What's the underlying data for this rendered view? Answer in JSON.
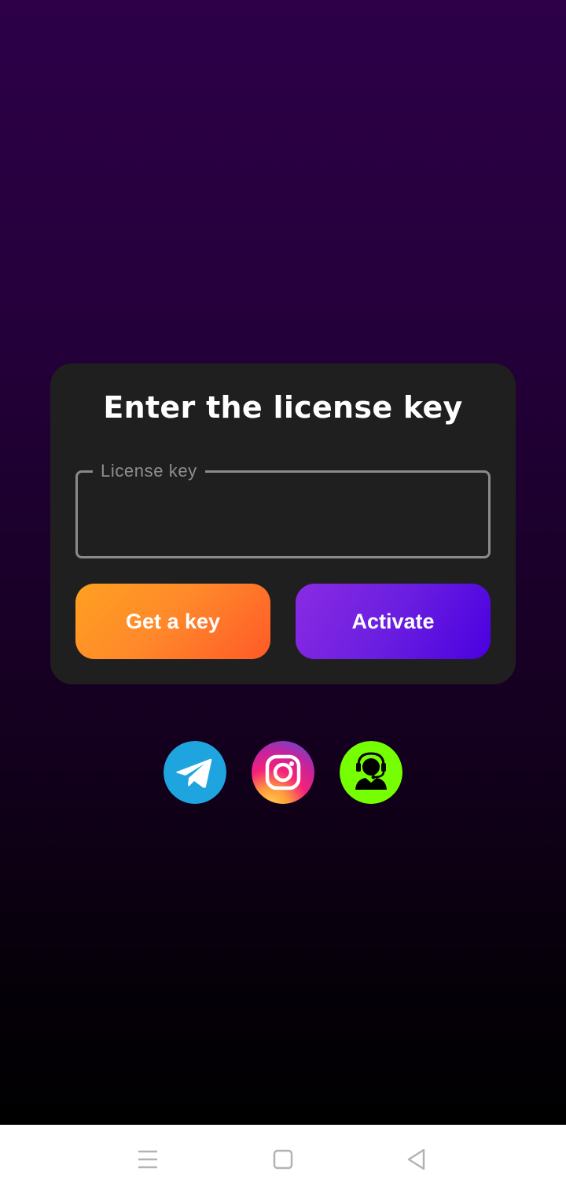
{
  "dialog": {
    "title": "Enter the license key",
    "field_label": "License key",
    "field_value": "",
    "get_key_label": "Get a key",
    "activate_label": "Activate"
  },
  "social": [
    {
      "name": "telegram",
      "icon": "telegram-icon",
      "color": "#1ea5e0"
    },
    {
      "name": "instagram",
      "icon": "instagram-icon",
      "color": "#e1306c"
    },
    {
      "name": "support",
      "icon": "support-agent-icon",
      "color": "#76ff03"
    }
  ],
  "navbar": {
    "items": [
      {
        "icon": "menu-icon"
      },
      {
        "icon": "home-square-icon"
      },
      {
        "icon": "back-triangle-icon"
      }
    ]
  },
  "colors": {
    "bg_top": "#2d0048",
    "bg_bottom": "#000000",
    "card": "#1f1f1f",
    "orange": "#ff8a2a",
    "purple": "#6a1ee0"
  }
}
